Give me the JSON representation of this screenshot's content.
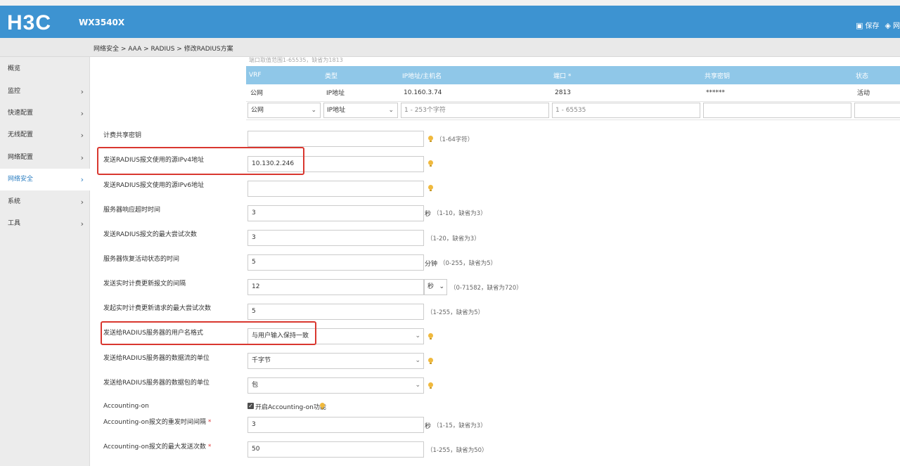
{
  "header": {
    "logo": "H3C",
    "model": "WX3540X",
    "save_label": "保存",
    "network_label": "网"
  },
  "breadcrumb": "网络安全 > AAA > RADIUS > 修改RADIUS方案",
  "sidebar": {
    "items": [
      {
        "label": "概览",
        "chevron": ""
      },
      {
        "label": "监控",
        "chevron": "›"
      },
      {
        "label": "快速配置",
        "chevron": "›"
      },
      {
        "label": "无线配置",
        "chevron": "›"
      },
      {
        "label": "网络配置",
        "chevron": "›"
      },
      {
        "label": "网络安全",
        "chevron": "›"
      },
      {
        "label": "系统",
        "chevron": "›"
      },
      {
        "label": "工具",
        "chevron": "›"
      }
    ]
  },
  "cut_text": "端口取值范围1-65535，缺省为1813",
  "server_table": {
    "columns": [
      "VRF",
      "类型",
      "IP地址/主机名",
      "端口 *",
      "共享密钥",
      "状态"
    ],
    "rows": [
      [
        "公网",
        "IP地址",
        "10.160.3.74",
        "2813",
        "******",
        "活动"
      ]
    ],
    "edit_row": {
      "vrf": "公网",
      "type": "IP地址",
      "ip_placeholder": "1 - 253个字符",
      "port_placeholder": "1 - 65535"
    }
  },
  "form": {
    "acct_key": {
      "label": "计费共享密钥",
      "value": "",
      "hint": "（1-64字符）"
    },
    "src_ipv4": {
      "label": "发送RADIUS报文使用的源IPv4地址",
      "value": "10.130.2.246"
    },
    "src_ipv6": {
      "label": "发送RADIUS报文使用的源IPv6地址",
      "value": ""
    },
    "timeout": {
      "label": "服务器响应超时时间",
      "value": "3",
      "unit": "秒",
      "hint": "（1-10，缺省为3）"
    },
    "retry": {
      "label": "发送RADIUS报文的最大尝试次数",
      "value": "3",
      "hint": "（1-20，缺省为3）"
    },
    "restore_time": {
      "label": "服务器恢复活动状态的时间",
      "value": "5",
      "unit": "分钟",
      "hint": "（0-255，缺省为5）"
    },
    "realtime_interval": {
      "label": "发送实时计费更新报文的间隔",
      "value": "12",
      "unit": "秒",
      "hint": "（0-71582，缺省为720）"
    },
    "realtime_retry": {
      "label": "发起实时计费更新请求的最大尝试次数",
      "value": "5",
      "hint": "（1-255，缺省为5）"
    },
    "username_format": {
      "label": "发送给RADIUS服务器的用户名格式",
      "value": "与用户输入保持一致"
    },
    "data_unit": {
      "label": "发送给RADIUS服务器的数据流的单位",
      "value": "千字节"
    },
    "packet_unit": {
      "label": "发送给RADIUS服务器的数据包的单位",
      "value": "包"
    },
    "accounting_on": {
      "label": "Accounting-on",
      "checkbox_label": "开启Accounting-on功能",
      "checked": true
    },
    "acct_on_interval": {
      "label": "Accounting-on报文的重发时间间隔",
      "value": "3",
      "unit": "秒",
      "hint": "（1-15，缺省为3）"
    },
    "acct_on_max": {
      "label": "Accounting-on报文的最大发送次数",
      "value": "50",
      "hint": "（1-255，缺省为50）"
    }
  }
}
